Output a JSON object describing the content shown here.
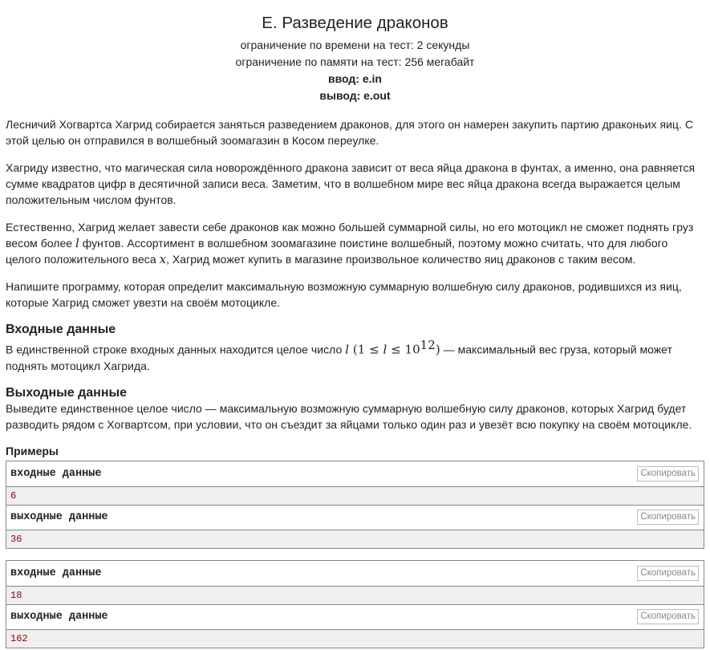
{
  "header": {
    "title": "E. Разведение драконов",
    "time_limit": "ограничение по времени на тест: 2 секунды",
    "memory_limit": "ограничение по памяти на тест: 256 мегабайт",
    "input_file": "ввод: e.in",
    "output_file": "вывод: e.out"
  },
  "statement": {
    "p1": "Лесничий Хогвартса Хагрид собирается заняться разведением драконов, для этого он намерен закупить партию драконьих яиц. С этой целью он отправился в волшебный зоомагазин в Косом переулке.",
    "p2": "Хагриду известно, что магическая сила новорождённого дракона зависит от веса яйца дракона в фунтах, а именно, она равняется сумме квадратов цифр в десятичной записи веса. Заметим, что в волшебном мире вес яйца дракона всегда выражается целым положительным числом фунтов.",
    "p3_a": "Естественно, Хагрид желает завести себе драконов как можно большей суммарной силы, но его мотоцикл не сможет поднять груз весом более ",
    "p3_var_l": "l",
    "p3_b": " фунтов. Ассортимент в волшебном зоомагазине поистине волшебный, поэтому можно считать, что для любого целого положительного веса ",
    "p3_var_x": "x",
    "p3_c": ", Хагрид может купить в магазине произвольное количество яиц драконов с таким весом.",
    "p4": "Напишите программу, которая определит максимальную возможную суммарную волшебную силу драконов, родившихся из яиц, которые Хагрид сможет увезти на своём мотоцикле."
  },
  "input_spec": {
    "title": "Входные данные",
    "text_a": "В единственной строке входных данных находится целое число ",
    "var_l": "l",
    "constraint_open": " (1 ≤ ",
    "constraint_var": "l",
    "constraint_mid": " ≤ 10",
    "constraint_exp": "12",
    "constraint_close": ")",
    "text_b": " — максимальный вес груза, который может поднять мотоцикл Хагрида."
  },
  "output_spec": {
    "title": "Выходные данные",
    "text": "Выведите единственное целое число — максимальную возможную суммарную волшебную силу драконов, которых Хагрид будет разводить рядом с Хогвартсом, при условии, что он съездит за яйцами только один раз и увезёт всю покупку на своём мотоцикле."
  },
  "samples": {
    "title": "Примеры",
    "input_label": "входные данные",
    "output_label": "выходные данные",
    "copy_label": "Скопировать",
    "tests": [
      {
        "input": "6",
        "output": "36"
      },
      {
        "input": "18",
        "output": "162"
      }
    ]
  }
}
